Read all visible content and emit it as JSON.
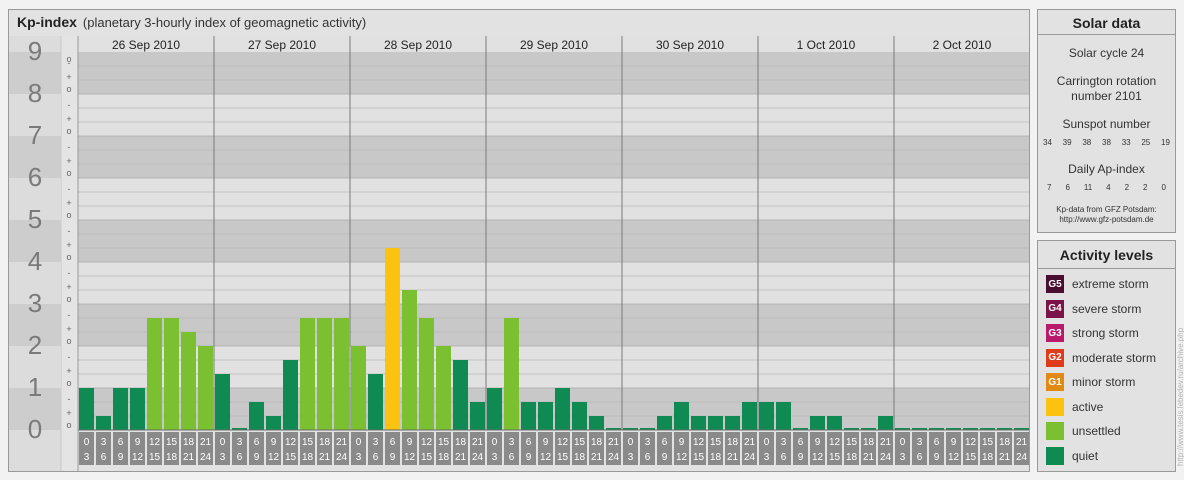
{
  "header": {
    "title": "Kp-index",
    "subtitle": "(planetary 3-hourly index of geomagnetic activity)"
  },
  "solar": {
    "title": "Solar data",
    "cycle": "Solar cycle 24",
    "carrington_1": "Carrington rotation",
    "carrington_2": "number 2101",
    "sunspot_title": "Sunspot number",
    "sunspot_values": [
      "34",
      "39",
      "38",
      "38",
      "33",
      "25",
      "19"
    ],
    "ap_title": "Daily Ap-index",
    "ap_values": [
      "7",
      "6",
      "11",
      "4",
      "2",
      "2",
      "0"
    ],
    "source_1": "Kp-data from GFZ Potsdam:",
    "source_2": "http://www.gfz-potsdam.de"
  },
  "activity": {
    "title": "Activity levels",
    "items": [
      {
        "badge": "G5",
        "label": "extreme storm",
        "color": "#4a0f2e"
      },
      {
        "badge": "G4",
        "label": "severe storm",
        "color": "#7a1448"
      },
      {
        "badge": "G3",
        "label": "strong storm",
        "color": "#b8196a"
      },
      {
        "badge": "G2",
        "label": "moderate storm",
        "color": "#dd3b1c"
      },
      {
        "badge": "G1",
        "label": "minor storm",
        "color": "#e08a14"
      },
      {
        "badge": "",
        "label": "active",
        "color": "#fbc30f"
      },
      {
        "badge": "",
        "label": "unsettled",
        "color": "#7ac030"
      },
      {
        "badge": "",
        "label": "quiet",
        "color": "#0e8a52"
      }
    ]
  },
  "credit": "http://www.tesis.lebedev.ru/archive.php",
  "chart_data": {
    "type": "bar",
    "ylim": [
      0,
      9
    ],
    "yticks": [
      "0",
      "1",
      "2",
      "3",
      "4",
      "5",
      "6",
      "7",
      "8",
      "9"
    ],
    "minor_ticks": [
      "o",
      "+",
      "-"
    ],
    "days": [
      "26 Sep 2010",
      "27 Sep 2010",
      "28 Sep 2010",
      "29 Sep 2010",
      "30 Sep 2010",
      "1 Oct 2010",
      "2 Oct 2010"
    ],
    "slot_start": [
      "0",
      "3",
      "6",
      "9",
      "12",
      "15",
      "18",
      "21"
    ],
    "slot_end": [
      "3",
      "6",
      "9",
      "12",
      "15",
      "18",
      "21",
      "24"
    ],
    "values": [
      [
        1.0,
        0.333,
        1.0,
        1.0,
        2.667,
        2.667,
        2.333,
        2.0
      ],
      [
        1.333,
        0.0,
        0.667,
        0.333,
        1.667,
        2.667,
        2.667,
        2.667
      ],
      [
        2.0,
        1.333,
        4.333,
        3.333,
        2.667,
        2.0,
        1.667,
        0.667
      ],
      [
        1.0,
        2.667,
        0.667,
        0.667,
        1.0,
        0.667,
        0.333,
        0.0
      ],
      [
        0.0,
        0.0,
        0.333,
        0.667,
        0.333,
        0.333,
        0.333,
        0.667
      ],
      [
        0.667,
        0.667,
        0.0,
        0.333,
        0.333,
        0.0,
        0.0,
        0.333
      ],
      [
        0.0,
        0.0,
        0.0,
        0.0,
        0.0,
        0.0,
        0.0,
        0.0
      ]
    ],
    "colors": {
      "quiet": "#0e8a52",
      "unsettled": "#7ac030",
      "active": "#fbc30f"
    }
  }
}
